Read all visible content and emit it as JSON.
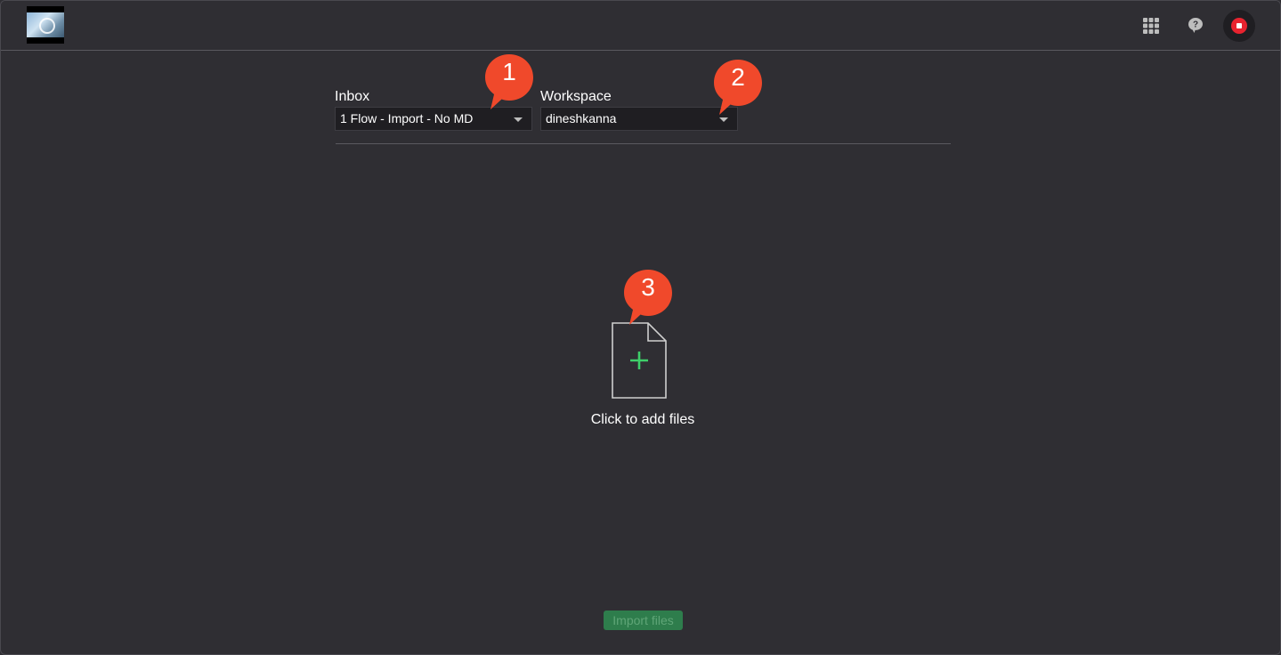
{
  "header": {
    "logo_icon": "app-logo",
    "apps_icon": "grid-icon",
    "help_icon": "help-icon",
    "record_icon": "record-stop-icon",
    "record_color": "#e8232f"
  },
  "form": {
    "inbox": {
      "label": "Inbox",
      "selected": "1 Flow - Import - No MD"
    },
    "workspace": {
      "label": "Workspace",
      "selected": "dineshkanna"
    }
  },
  "annotations": {
    "marker_1": "1",
    "marker_2": "2",
    "marker_3": "3",
    "marker_color": "#f0492b"
  },
  "dropzone": {
    "icon": "file-add-icon",
    "label": "Click to add files",
    "plus_color": "#3ecf6a"
  },
  "footer": {
    "import_label": "Import files",
    "import_color": "#2e7d4c"
  }
}
